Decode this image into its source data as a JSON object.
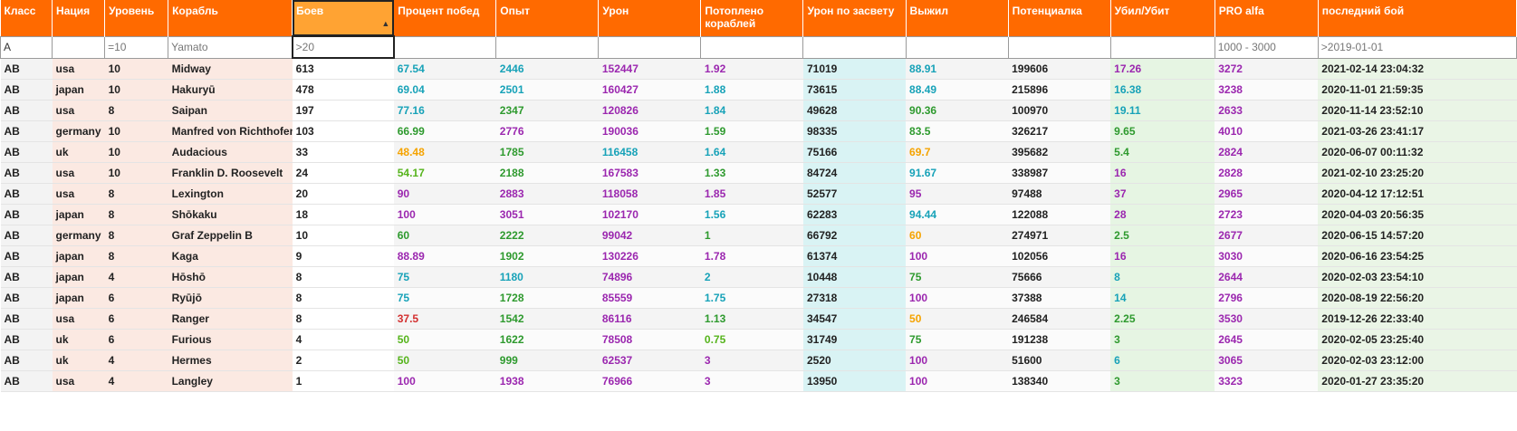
{
  "columns": [
    {
      "key": "class",
      "label": "Класс",
      "filter_value": "A",
      "filter_placeholder": ""
    },
    {
      "key": "nation",
      "label": "Нация",
      "filter_value": "",
      "filter_placeholder": ""
    },
    {
      "key": "tier",
      "label": "Уровень",
      "filter_value": "",
      "filter_placeholder": "=10"
    },
    {
      "key": "ship",
      "label": "Корабль",
      "filter_value": "",
      "filter_placeholder": "Yamato"
    },
    {
      "key": "battles",
      "label": "Боев",
      "filter_value": "",
      "filter_placeholder": ">20",
      "sorted": "desc"
    },
    {
      "key": "winrate",
      "label": "Процент побед",
      "filter_value": "",
      "filter_placeholder": ""
    },
    {
      "key": "xp",
      "label": "Опыт",
      "filter_value": "",
      "filter_placeholder": ""
    },
    {
      "key": "damage",
      "label": "Урон",
      "filter_value": "",
      "filter_placeholder": ""
    },
    {
      "key": "frags",
      "label": "Потоплено кораблей",
      "filter_value": "",
      "filter_placeholder": ""
    },
    {
      "key": "spot",
      "label": "Урон по засвету",
      "filter_value": "",
      "filter_placeholder": ""
    },
    {
      "key": "survived",
      "label": "Выжил",
      "filter_value": "",
      "filter_placeholder": ""
    },
    {
      "key": "potential",
      "label": "Потенциалка",
      "filter_value": "",
      "filter_placeholder": ""
    },
    {
      "key": "kd",
      "label": "Убил/Убит",
      "filter_value": "",
      "filter_placeholder": ""
    },
    {
      "key": "pro",
      "label": "PRO alfa",
      "filter_value": "",
      "filter_placeholder": "1000 - 3000"
    },
    {
      "key": "last",
      "label": "последний бой",
      "filter_value": "",
      "filter_placeholder": ">2019-01-01"
    }
  ],
  "colors": {
    "header_bg": "#ff6a00",
    "sorted_header_bg": "#ffa333",
    "purple": "#9b27af",
    "cyan": "#17a2b8",
    "green": "#2e9a2e",
    "lime": "#56b41c",
    "orange": "#f5a300",
    "red": "#d32f2f",
    "dark": "#222222"
  },
  "rows": [
    {
      "class": "AB",
      "nation": "usa",
      "tier": "10",
      "ship": "Midway",
      "battles": "613",
      "winrate": "67.54",
      "xp": "2446",
      "damage": "152447",
      "frags": "1.92",
      "spot": "71019",
      "survived": "88.91",
      "potential": "199606",
      "kd": "17.26",
      "pro": "3272",
      "last": "2021-02-14 23:04:32",
      "c": {
        "winrate": "cyan",
        "xp": "cyan",
        "damage": "purple",
        "frags": "purple",
        "survived": "cyan",
        "kd": "purple",
        "pro": "purple"
      }
    },
    {
      "class": "AB",
      "nation": "japan",
      "tier": "10",
      "ship": "Hakuryū",
      "battles": "478",
      "winrate": "69.04",
      "xp": "2501",
      "damage": "160427",
      "frags": "1.88",
      "spot": "73615",
      "survived": "88.49",
      "potential": "215896",
      "kd": "16.38",
      "pro": "3238",
      "last": "2020-11-01 21:59:35",
      "c": {
        "winrate": "cyan",
        "xp": "cyan",
        "damage": "purple",
        "frags": "cyan",
        "survived": "cyan",
        "kd": "cyan",
        "pro": "purple"
      }
    },
    {
      "class": "AB",
      "nation": "usa",
      "tier": "8",
      "ship": "Saipan",
      "battles": "197",
      "winrate": "77.16",
      "xp": "2347",
      "damage": "120826",
      "frags": "1.84",
      "spot": "49628",
      "survived": "90.36",
      "potential": "100970",
      "kd": "19.11",
      "pro": "2633",
      "last": "2020-11-14 23:52:10",
      "c": {
        "winrate": "cyan",
        "xp": "green",
        "damage": "purple",
        "frags": "cyan",
        "survived": "green",
        "kd": "cyan",
        "pro": "purple"
      }
    },
    {
      "class": "AB",
      "nation": "germany",
      "tier": "10",
      "ship": "Manfred von Richthofen",
      "battles": "103",
      "winrate": "66.99",
      "xp": "2776",
      "damage": "190036",
      "frags": "1.59",
      "spot": "98335",
      "survived": "83.5",
      "potential": "326217",
      "kd": "9.65",
      "pro": "4010",
      "last": "2021-03-26 23:41:17",
      "c": {
        "winrate": "green",
        "xp": "purple",
        "damage": "purple",
        "frags": "green",
        "survived": "green",
        "kd": "green",
        "pro": "purple"
      }
    },
    {
      "class": "AB",
      "nation": "uk",
      "tier": "10",
      "ship": "Audacious",
      "battles": "33",
      "winrate": "48.48",
      "xp": "1785",
      "damage": "116458",
      "frags": "1.64",
      "spot": "75166",
      "survived": "69.7",
      "potential": "395682",
      "kd": "5.4",
      "pro": "2824",
      "last": "2020-06-07 00:11:32",
      "c": {
        "winrate": "orange",
        "xp": "green",
        "damage": "cyan",
        "frags": "cyan",
        "survived": "orange",
        "kd": "green",
        "pro": "purple"
      }
    },
    {
      "class": "AB",
      "nation": "usa",
      "tier": "10",
      "ship": "Franklin D. Roosevelt",
      "battles": "24",
      "winrate": "54.17",
      "xp": "2188",
      "damage": "167583",
      "frags": "1.33",
      "spot": "84724",
      "survived": "91.67",
      "potential": "338987",
      "kd": "16",
      "pro": "2828",
      "last": "2021-02-10 23:25:20",
      "c": {
        "winrate": "lime",
        "xp": "green",
        "damage": "purple",
        "frags": "green",
        "survived": "cyan",
        "kd": "purple",
        "pro": "purple"
      }
    },
    {
      "class": "AB",
      "nation": "usa",
      "tier": "8",
      "ship": "Lexington",
      "battles": "20",
      "winrate": "90",
      "xp": "2883",
      "damage": "118058",
      "frags": "1.85",
      "spot": "52577",
      "survived": "95",
      "potential": "97488",
      "kd": "37",
      "pro": "2965",
      "last": "2020-04-12 17:12:51",
      "c": {
        "winrate": "purple",
        "xp": "purple",
        "damage": "purple",
        "frags": "purple",
        "survived": "purple",
        "kd": "purple",
        "pro": "purple"
      }
    },
    {
      "class": "AB",
      "nation": "japan",
      "tier": "8",
      "ship": "Shōkaku",
      "battles": "18",
      "winrate": "100",
      "xp": "3051",
      "damage": "102170",
      "frags": "1.56",
      "spot": "62283",
      "survived": "94.44",
      "potential": "122088",
      "kd": "28",
      "pro": "2723",
      "last": "2020-04-03 20:56:35",
      "c": {
        "winrate": "purple",
        "xp": "purple",
        "damage": "purple",
        "frags": "cyan",
        "survived": "cyan",
        "kd": "purple",
        "pro": "purple"
      }
    },
    {
      "class": "AB",
      "nation": "germany",
      "tier": "8",
      "ship": "Graf Zeppelin B",
      "battles": "10",
      "winrate": "60",
      "xp": "2222",
      "damage": "99042",
      "frags": "1",
      "spot": "66792",
      "survived": "60",
      "potential": "274971",
      "kd": "2.5",
      "pro": "2677",
      "last": "2020-06-15 14:57:20",
      "c": {
        "winrate": "green",
        "xp": "green",
        "damage": "purple",
        "frags": "green",
        "survived": "orange",
        "kd": "green",
        "pro": "purple"
      }
    },
    {
      "class": "AB",
      "nation": "japan",
      "tier": "8",
      "ship": "Kaga",
      "battles": "9",
      "winrate": "88.89",
      "xp": "1902",
      "damage": "130226",
      "frags": "1.78",
      "spot": "61374",
      "survived": "100",
      "potential": "102056",
      "kd": "16",
      "pro": "3030",
      "last": "2020-06-16 23:54:25",
      "c": {
        "winrate": "purple",
        "xp": "green",
        "damage": "purple",
        "frags": "purple",
        "survived": "purple",
        "kd": "purple",
        "pro": "purple"
      }
    },
    {
      "class": "AB",
      "nation": "japan",
      "tier": "4",
      "ship": "Hōshō",
      "battles": "8",
      "winrate": "75",
      "xp": "1180",
      "damage": "74896",
      "frags": "2",
      "spot": "10448",
      "survived": "75",
      "potential": "75666",
      "kd": "8",
      "pro": "2644",
      "last": "2020-02-03 23:54:10",
      "c": {
        "winrate": "cyan",
        "xp": "cyan",
        "damage": "purple",
        "frags": "cyan",
        "survived": "green",
        "kd": "cyan",
        "pro": "purple"
      }
    },
    {
      "class": "AB",
      "nation": "japan",
      "tier": "6",
      "ship": "Ryūjō",
      "battles": "8",
      "winrate": "75",
      "xp": "1728",
      "damage": "85559",
      "frags": "1.75",
      "spot": "27318",
      "survived": "100",
      "potential": "37388",
      "kd": "14",
      "pro": "2796",
      "last": "2020-08-19 22:56:20",
      "c": {
        "winrate": "cyan",
        "xp": "green",
        "damage": "purple",
        "frags": "cyan",
        "survived": "purple",
        "kd": "cyan",
        "pro": "purple"
      }
    },
    {
      "class": "AB",
      "nation": "usa",
      "tier": "6",
      "ship": "Ranger",
      "battles": "8",
      "winrate": "37.5",
      "xp": "1542",
      "damage": "86116",
      "frags": "1.13",
      "spot": "34547",
      "survived": "50",
      "potential": "246584",
      "kd": "2.25",
      "pro": "3530",
      "last": "2019-12-26 22:33:40",
      "c": {
        "winrate": "red",
        "xp": "green",
        "damage": "purple",
        "frags": "green",
        "survived": "orange",
        "kd": "green",
        "pro": "purple"
      }
    },
    {
      "class": "AB",
      "nation": "uk",
      "tier": "6",
      "ship": "Furious",
      "battles": "4",
      "winrate": "50",
      "xp": "1622",
      "damage": "78508",
      "frags": "0.75",
      "spot": "31749",
      "survived": "75",
      "potential": "191238",
      "kd": "3",
      "pro": "2645",
      "last": "2020-02-05 23:25:40",
      "c": {
        "winrate": "lime",
        "xp": "green",
        "damage": "purple",
        "frags": "lime",
        "survived": "green",
        "kd": "green",
        "pro": "purple"
      }
    },
    {
      "class": "AB",
      "nation": "uk",
      "tier": "4",
      "ship": "Hermes",
      "battles": "2",
      "winrate": "50",
      "xp": "999",
      "damage": "62537",
      "frags": "3",
      "spot": "2520",
      "survived": "100",
      "potential": "51600",
      "kd": "6",
      "pro": "3065",
      "last": "2020-02-03 23:12:00",
      "c": {
        "winrate": "lime",
        "xp": "green",
        "damage": "purple",
        "frags": "purple",
        "survived": "purple",
        "kd": "cyan",
        "pro": "purple"
      }
    },
    {
      "class": "AB",
      "nation": "usa",
      "tier": "4",
      "ship": "Langley",
      "battles": "1",
      "winrate": "100",
      "xp": "1938",
      "damage": "76966",
      "frags": "3",
      "spot": "13950",
      "survived": "100",
      "potential": "138340",
      "kd": "3",
      "pro": "3323",
      "last": "2020-01-27 23:35:20",
      "c": {
        "winrate": "purple",
        "xp": "purple",
        "damage": "purple",
        "frags": "purple",
        "survived": "purple",
        "kd": "green",
        "pro": "purple"
      }
    }
  ]
}
